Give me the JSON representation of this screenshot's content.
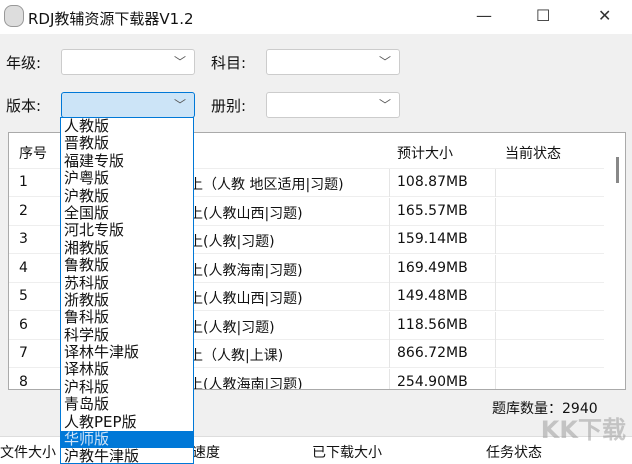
{
  "window": {
    "title": "RDJ教辅资源下载器V1.2",
    "minimize": "—",
    "maximize": "☐",
    "close": "✕"
  },
  "filters": {
    "grade_label": "年级:",
    "subject_label": "科目:",
    "edition_label": "版本:",
    "volume_label": "册别:"
  },
  "table": {
    "headers": [
      "序号",
      "",
      "预计大小",
      "当前状态"
    ],
    "rows": [
      {
        "no": "1",
        "name": "上（人教 地区适用|习题)",
        "size": "108.87MB",
        "status": ""
      },
      {
        "no": "2",
        "name": "上(人教山西|习题)",
        "size": "165.57MB",
        "status": ""
      },
      {
        "no": "3",
        "name": "上(人教|习题)",
        "size": "159.14MB",
        "status": ""
      },
      {
        "no": "4",
        "name": "上(人教海南|习题)",
        "size": "169.49MB",
        "status": ""
      },
      {
        "no": "5",
        "name": "上(人教山西|习题)",
        "size": "149.48MB",
        "status": ""
      },
      {
        "no": "6",
        "name": "上(人教|习题)",
        "size": "118.56MB",
        "status": ""
      },
      {
        "no": "7",
        "name": "上（人教|上课)",
        "size": "866.72MB",
        "status": ""
      },
      {
        "no": "8",
        "name": "上(人教海南|习题)",
        "size": "254.90MB",
        "status": ""
      }
    ]
  },
  "count_label": "题库数量：2940",
  "tasks_headers": [
    "文件大小",
    "速度",
    "已下载大小",
    "任务状态"
  ],
  "edition_options": [
    "人教版",
    "晋教版",
    "福建专版",
    "沪粤版",
    "沪教版",
    "全国版",
    "河北专版",
    "湘教版",
    "鲁教版",
    "苏科版",
    "浙教版",
    "鲁科版",
    "科学版",
    "译林牛津版",
    "译林版",
    "沪科版",
    "青岛版",
    "人教PEP版",
    "华师版",
    "沪教牛津版"
  ],
  "selected_option_index": 18,
  "watermark": "KK下载"
}
